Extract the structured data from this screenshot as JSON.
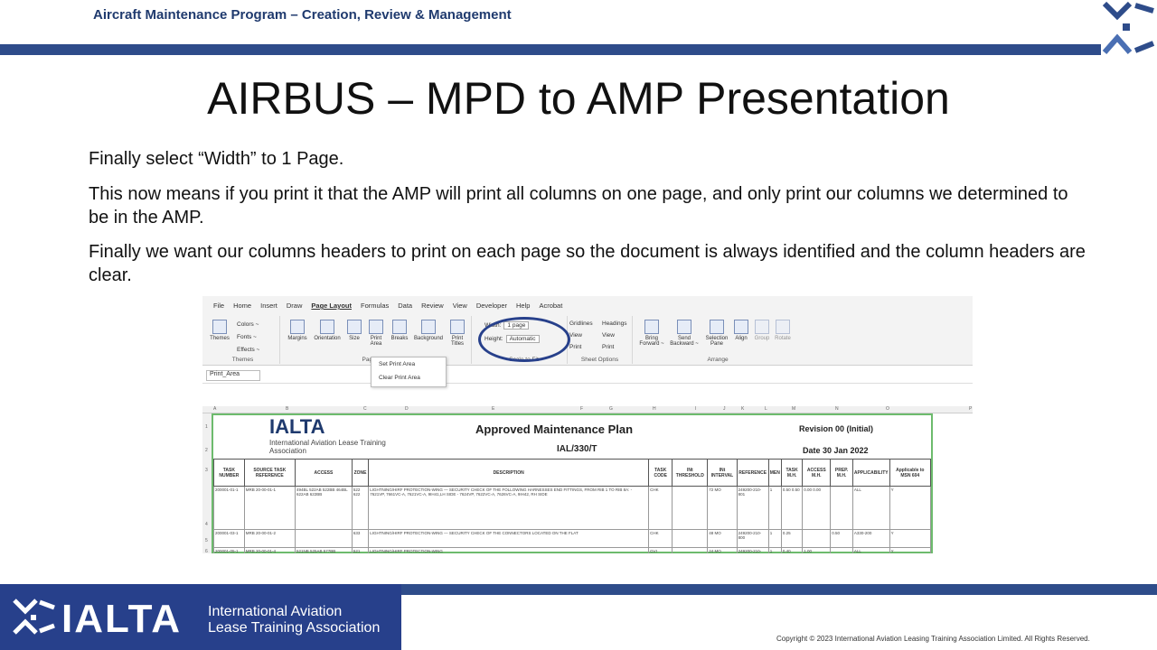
{
  "header": {
    "program_title": "Aircraft Maintenance Program – Creation, Review & Management",
    "brand_color": "#2e4c8a",
    "logo": "ialta-mark-icon"
  },
  "slide": {
    "title": "AIRBUS – MPD to AMP Presentation",
    "paragraphs": [
      "Finally select “Width” to 1 Page.",
      "This now means if you print it that the AMP will print all columns on one page, and only print our columns we determined to be in the AMP.",
      "Finally we want our columns headers to print on each page so the document is always identified and the column headers are clear."
    ]
  },
  "excel": {
    "tabs": [
      "File",
      "Home",
      "Insert",
      "Draw",
      "Page Layout",
      "Formulas",
      "Data",
      "Review",
      "View",
      "Developer",
      "Help",
      "Acrobat"
    ],
    "active_tab": "Page Layout",
    "groups": {
      "themes": {
        "label": "Themes",
        "buttons": [
          "Themes",
          "Colors ~",
          "Fonts ~",
          "Effects ~"
        ]
      },
      "page_setup": {
        "label": "Page Setup",
        "buttons": [
          "Margins",
          "Orientation",
          "Size",
          "Print Area",
          "Breaks",
          "Background",
          "Print Titles"
        ]
      },
      "scale_to_fit": {
        "label": "Scale to Fit",
        "width_label": "Width:",
        "width_value": "1 page",
        "height_label": "Height:",
        "height_value": "Automatic"
      },
      "sheet_options": {
        "label": "Sheet Options",
        "gridlines": "Gridlines",
        "headings": "Headings",
        "view": "View",
        "print": "Print"
      },
      "arrange": {
        "label": "Arrange",
        "buttons": [
          "Bring Forward ~",
          "Send Backward ~",
          "Selection Pane",
          "Align",
          "Group",
          "Rotate"
        ]
      }
    },
    "print_area_menu": [
      "Set Print Area",
      "Clear Print Area"
    ],
    "name_box": "Print_Area",
    "column_letters": [
      "A",
      "B",
      "C",
      "D",
      "E",
      "F",
      "G",
      "H",
      "I",
      "J",
      "K",
      "L",
      "M",
      "N",
      "O",
      "P"
    ],
    "row_numbers": [
      "1",
      "2",
      "3",
      "4",
      "5",
      "6"
    ],
    "sheet": {
      "org_short": "IALTA",
      "org_full": "International Aviation Lease Training Association",
      "plan_title": "Approved Maintenance Plan",
      "doc_number": "IAL/330/T",
      "revision": "Revision 00 (Initial)",
      "date": "Date 30 Jan 2022",
      "headers": [
        "TASK NUMBER",
        "SOURCE TASK REFERENCE",
        "ACCESS",
        "ZONE",
        "DESCRIPTION",
        "TASK CODE",
        "INt THRESHOLD",
        "INt INTERVAL",
        "REFERENCE",
        "MEN",
        "TASK M.H.",
        "ACCESS M.H.",
        "PREP. M.H.",
        "APPLICABILITY",
        "Applicable to MSN 604"
      ],
      "rows": [
        [
          "200001-01-1",
          "MRB 20-00-01-1",
          "494BL 522AB 522BB 464BL 622AB 622BB",
          "522 622",
          "LIGHTNING/HIRF PROTECTION-WING — SECURITY CHECK OF THE FOLLOWING HARNESSES END FITTINGS, FROM RIB 1 TO RIB 8A: - 7621VP, 7661VC-A, 7621VC-A, 9IH41,LH SIDE - 7624VP, 7622VC-A, 7626VC-A, 9IH42, RH SIDE",
          "CHK",
          "",
          "72 MO",
          "249200-210-801",
          "1",
          "0.50 0.50",
          "0.00 0.00",
          "",
          "ALL",
          "Y"
        ],
        [
          "200001-03-1",
          "MRB 20-00-01-2",
          "",
          "633",
          "LIGHTNING/HIRF PROTECTION-WING — SECURITY CHECK OF THE CONNECTORS LOCATED ON THE FLAT",
          "CHK",
          "",
          "48 MO",
          "249200-210-800",
          "1",
          "0.25",
          "",
          "0.50",
          "A330-200",
          "Y"
        ],
        [
          "200001-05-1",
          "MRB 20-00-01-4",
          "521NB 525AB 577BB",
          "521",
          "LIGHTNING/HIRF PROTECTION-WING",
          "GVI",
          "",
          "24 MO",
          "249200-210-804",
          "1",
          "0.40",
          "1.00",
          "",
          "ALL",
          "Y"
        ]
      ]
    }
  },
  "footer": {
    "brand": "IALTA",
    "org_line1": "International Aviation",
    "org_line2": "Lease Training Association",
    "copyright": "Copyright © 2023 International Aviation Leasing Training Association Limited. All Rights Reserved."
  }
}
